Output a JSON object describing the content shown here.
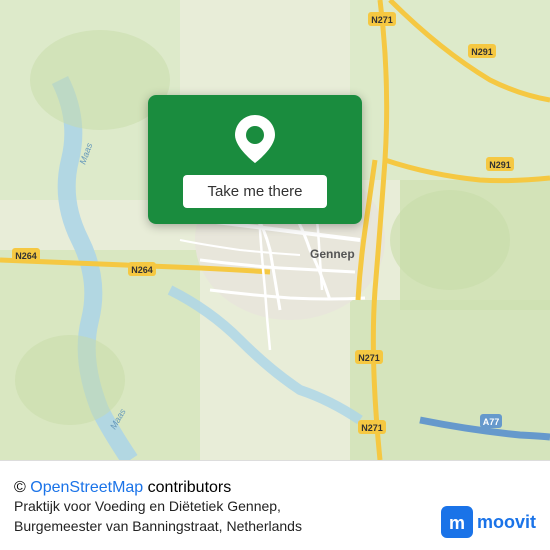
{
  "map": {
    "alt": "Map of Gennep, Netherlands"
  },
  "card": {
    "button_label": "Take me there"
  },
  "footer": {
    "osm_prefix": "©",
    "osm_link": "OpenStreetMap",
    "osm_suffix": "contributors",
    "place_name": "Praktijk voor Voeding en Diëtetiek Gennep,",
    "place_address": "Burgemeester van Banningstraat, Netherlands"
  },
  "moovit": {
    "logo_text": "moovit"
  }
}
